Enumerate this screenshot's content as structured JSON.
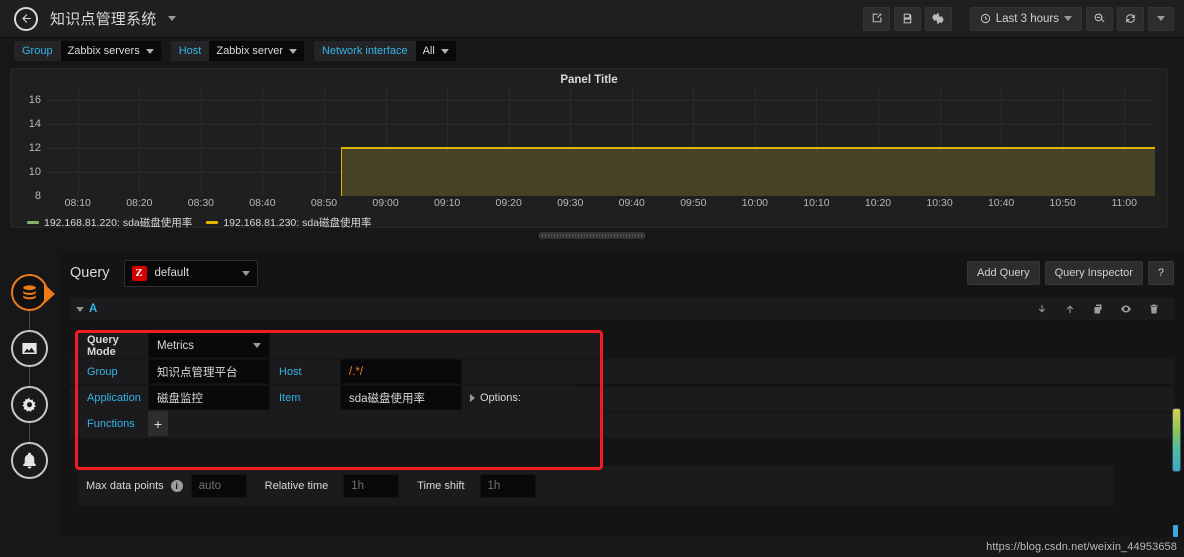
{
  "topnav": {
    "back_icon": "arrow-left-icon",
    "dashboard_title": "知识点管理系统",
    "share_icon": "share-icon",
    "save_icon": "save-icon",
    "settings_icon": "gear-icon",
    "time_range": "Last 3 hours",
    "clock_icon": "clock-icon",
    "zoom_out_icon": "zoom-out-icon",
    "refresh_icon": "refresh-icon"
  },
  "variables": [
    {
      "label": "Group",
      "value": "Zabbix servers"
    },
    {
      "label": "Host",
      "value": "Zabbix server"
    },
    {
      "label": "Network interface",
      "value": "All"
    }
  ],
  "panel": {
    "title": "Panel Title",
    "legend": [
      {
        "label": "192.168.81.220: sda磁盘使用率",
        "color": "#7eb26d"
      },
      {
        "label": "192.168.81.230: sda磁盘使用率",
        "color": "#e0b400"
      }
    ]
  },
  "chart_data": {
    "type": "area",
    "title": "Panel Title",
    "xlabel": "",
    "ylabel": "",
    "ylim": [
      8,
      17
    ],
    "yticks": [
      8,
      10,
      12,
      14,
      16
    ],
    "xticks": [
      "08:10",
      "08:20",
      "08:30",
      "08:40",
      "08:50",
      "09:00",
      "09:10",
      "09:20",
      "09:30",
      "09:40",
      "09:50",
      "10:00",
      "10:10",
      "10:20",
      "10:30",
      "10:40",
      "10:50",
      "11:00"
    ],
    "grid": true,
    "legend_position": "bottom-left",
    "series": [
      {
        "name": "192.168.81.220: sda磁盘使用率",
        "color": "#7eb26d",
        "values": []
      },
      {
        "name": "192.168.81.230: sda磁盘使用率",
        "color": "#e0b400",
        "x": [
          "08:53",
          "09:00",
          "09:10",
          "09:20",
          "09:30",
          "09:40",
          "09:50",
          "10:00",
          "10:10",
          "10:20",
          "10:30",
          "10:40",
          "10:50",
          "11:00",
          "11:05"
        ],
        "values": [
          12,
          12,
          12,
          12,
          12,
          12,
          12,
          12,
          12,
          12,
          12,
          12,
          12,
          12,
          12
        ]
      }
    ]
  },
  "editor": {
    "query_label": "Query",
    "datasource_logo": "Z",
    "datasource_name": "default",
    "add_query_label": "Add Query",
    "query_inspector_label": "Query Inspector",
    "help_label": "?",
    "row_letter": "A",
    "row_icons": [
      "move-down-icon",
      "move-up-icon",
      "duplicate-icon",
      "eye-icon",
      "trash-icon"
    ],
    "fields": {
      "query_mode_label": "Query Mode",
      "query_mode_value": "Metrics",
      "group_label": "Group",
      "group_value": "知识点管理平台",
      "host_label": "Host",
      "host_value": "/.*/",
      "application_label": "Application",
      "application_value": "磁盘监控",
      "item_label": "Item",
      "item_value": "sda磁盘使用率",
      "options_label": "Options:",
      "functions_label": "Functions",
      "functions_add": "+"
    },
    "options": {
      "max_data_points_label": "Max data points",
      "max_data_points_placeholder": "auto",
      "relative_time_label": "Relative time",
      "relative_time_placeholder": "1h",
      "time_shift_label": "Time shift",
      "time_shift_placeholder": "1h"
    }
  },
  "sidebar": [
    {
      "name": "queries-tab",
      "icon": "database-icon",
      "active": true
    },
    {
      "name": "visualization-tab",
      "icon": "graph-icon",
      "active": false
    },
    {
      "name": "general-tab",
      "icon": "gear-wrench-icon",
      "active": false
    },
    {
      "name": "alert-tab",
      "icon": "bell-icon",
      "active": false
    }
  ],
  "watermark": "https://blog.csdn.net/weixin_44953658"
}
